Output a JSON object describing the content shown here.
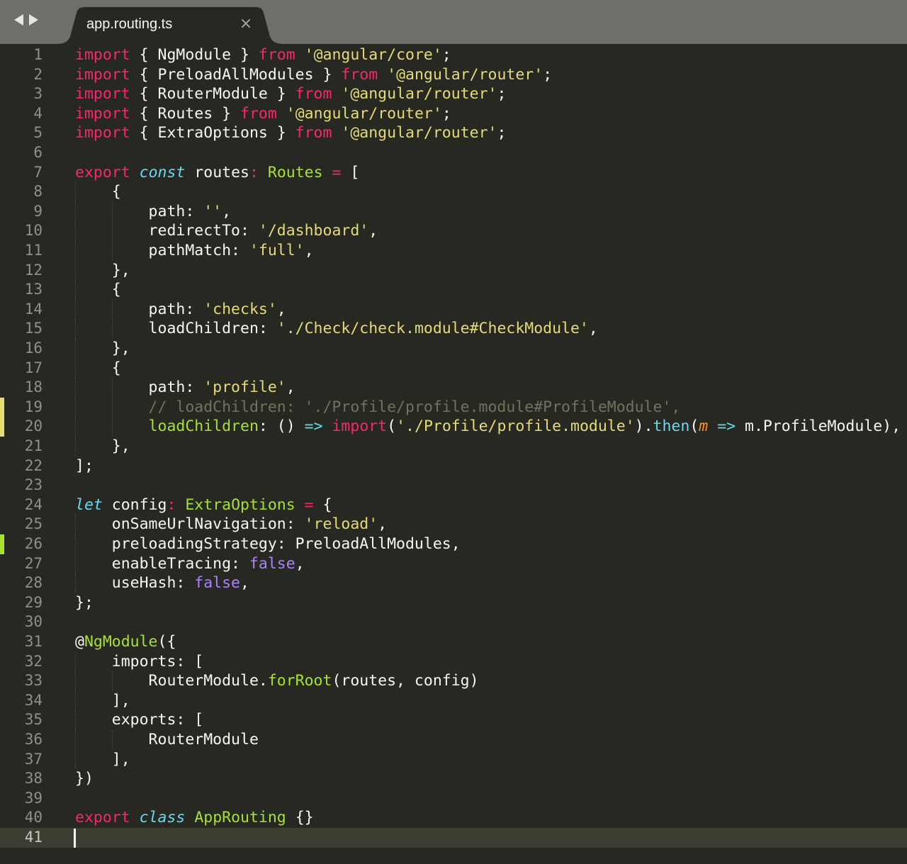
{
  "tabbar": {
    "back_label": "◀",
    "forward_label": "▶",
    "tab_title": "app.routing.ts",
    "close_label": "×"
  },
  "editor": {
    "current_line": 41,
    "markers": {
      "19": "modified",
      "20": "modified",
      "26": "added"
    },
    "lines": [
      [
        [
          "kw",
          "import"
        ],
        [
          "p",
          " { NgModule } "
        ],
        [
          "kw",
          "from"
        ],
        [
          "p",
          " "
        ],
        [
          "s",
          "'@angular/core'"
        ],
        [
          "p",
          ";"
        ]
      ],
      [
        [
          "kw",
          "import"
        ],
        [
          "p",
          " { PreloadAllModules } "
        ],
        [
          "kw",
          "from"
        ],
        [
          "p",
          " "
        ],
        [
          "s",
          "'@angular/router'"
        ],
        [
          "p",
          ";"
        ]
      ],
      [
        [
          "kw",
          "import"
        ],
        [
          "p",
          " { RouterModule } "
        ],
        [
          "kw",
          "from"
        ],
        [
          "p",
          " "
        ],
        [
          "s",
          "'@angular/router'"
        ],
        [
          "p",
          ";"
        ]
      ],
      [
        [
          "kw",
          "import"
        ],
        [
          "p",
          " { Routes } "
        ],
        [
          "kw",
          "from"
        ],
        [
          "p",
          " "
        ],
        [
          "s",
          "'@angular/router'"
        ],
        [
          "p",
          ";"
        ]
      ],
      [
        [
          "kw",
          "import"
        ],
        [
          "p",
          " { ExtraOptions } "
        ],
        [
          "kw",
          "from"
        ],
        [
          "p",
          " "
        ],
        [
          "s",
          "'@angular/router'"
        ],
        [
          "p",
          ";"
        ]
      ],
      [],
      [
        [
          "kw",
          "export"
        ],
        [
          "p",
          " "
        ],
        [
          "st",
          "const"
        ],
        [
          "p",
          " routes"
        ],
        [
          "kw",
          ":"
        ],
        [
          "p",
          " "
        ],
        [
          "cl",
          "Routes"
        ],
        [
          "p",
          " "
        ],
        [
          "kw",
          "="
        ],
        [
          "p",
          " ["
        ]
      ],
      [
        [
          "p",
          "    {"
        ]
      ],
      [
        [
          "p",
          "        path: "
        ],
        [
          "s",
          "''"
        ],
        [
          "p",
          ","
        ]
      ],
      [
        [
          "p",
          "        redirectTo: "
        ],
        [
          "s",
          "'/dashboard'"
        ],
        [
          "p",
          ","
        ]
      ],
      [
        [
          "p",
          "        pathMatch: "
        ],
        [
          "s",
          "'full'"
        ],
        [
          "p",
          ","
        ]
      ],
      [
        [
          "p",
          "    },"
        ]
      ],
      [
        [
          "p",
          "    {"
        ]
      ],
      [
        [
          "p",
          "        path: "
        ],
        [
          "s",
          "'checks'"
        ],
        [
          "p",
          ","
        ]
      ],
      [
        [
          "p",
          "        loadChildren: "
        ],
        [
          "s",
          "'./Check/check.module#CheckModule'"
        ],
        [
          "p",
          ","
        ]
      ],
      [
        [
          "p",
          "    },"
        ]
      ],
      [
        [
          "p",
          "    {"
        ]
      ],
      [
        [
          "p",
          "        path: "
        ],
        [
          "s",
          "'profile'"
        ],
        [
          "p",
          ","
        ]
      ],
      [
        [
          "co",
          "        // loadChildren: './Profile/profile.module#ProfileModule',"
        ]
      ],
      [
        [
          "p",
          "        "
        ],
        [
          "cl",
          "loadChildren"
        ],
        [
          "p",
          ": () "
        ],
        [
          "fn",
          "=>"
        ],
        [
          "p",
          " "
        ],
        [
          "kw",
          "import"
        ],
        [
          "p",
          "("
        ],
        [
          "s",
          "'./Profile/profile.module'"
        ],
        [
          "p",
          ")."
        ],
        [
          "fn",
          "then"
        ],
        [
          "p",
          "("
        ],
        [
          "par",
          "m"
        ],
        [
          "p",
          " "
        ],
        [
          "fn",
          "=>"
        ],
        [
          "p",
          " m.ProfileModule),"
        ]
      ],
      [
        [
          "p",
          "    },"
        ]
      ],
      [
        [
          "p",
          "];"
        ]
      ],
      [],
      [
        [
          "st",
          "let"
        ],
        [
          "p",
          " config"
        ],
        [
          "kw",
          ":"
        ],
        [
          "p",
          " "
        ],
        [
          "cl",
          "ExtraOptions"
        ],
        [
          "p",
          " "
        ],
        [
          "kw",
          "="
        ],
        [
          "p",
          " {"
        ]
      ],
      [
        [
          "p",
          "    onSameUrlNavigation: "
        ],
        [
          "s",
          "'reload'"
        ],
        [
          "p",
          ","
        ]
      ],
      [
        [
          "p",
          "    preloadingStrategy: PreloadAllModules,"
        ]
      ],
      [
        [
          "p",
          "    enableTracing: "
        ],
        [
          "bool",
          "false"
        ],
        [
          "p",
          ","
        ]
      ],
      [
        [
          "p",
          "    useHash: "
        ],
        [
          "bool",
          "false"
        ],
        [
          "p",
          ","
        ]
      ],
      [
        [
          "p",
          "};"
        ]
      ],
      [],
      [
        [
          "p",
          "@"
        ],
        [
          "cl",
          "NgModule"
        ],
        [
          "p",
          "({"
        ]
      ],
      [
        [
          "p",
          "    imports: ["
        ]
      ],
      [
        [
          "p",
          "        RouterModule."
        ],
        [
          "cl",
          "forRoot"
        ],
        [
          "p",
          "(routes, config)"
        ]
      ],
      [
        [
          "p",
          "    ],"
        ]
      ],
      [
        [
          "p",
          "    exports: ["
        ]
      ],
      [
        [
          "p",
          "        RouterModule"
        ]
      ],
      [
        [
          "p",
          "    ],"
        ]
      ],
      [
        [
          "p",
          "})"
        ]
      ],
      [],
      [
        [
          "kw",
          "export"
        ],
        [
          "p",
          " "
        ],
        [
          "st",
          "class"
        ],
        [
          "p",
          " "
        ],
        [
          "cl",
          "AppRouting"
        ],
        [
          "p",
          " {}"
        ]
      ],
      []
    ]
  }
}
